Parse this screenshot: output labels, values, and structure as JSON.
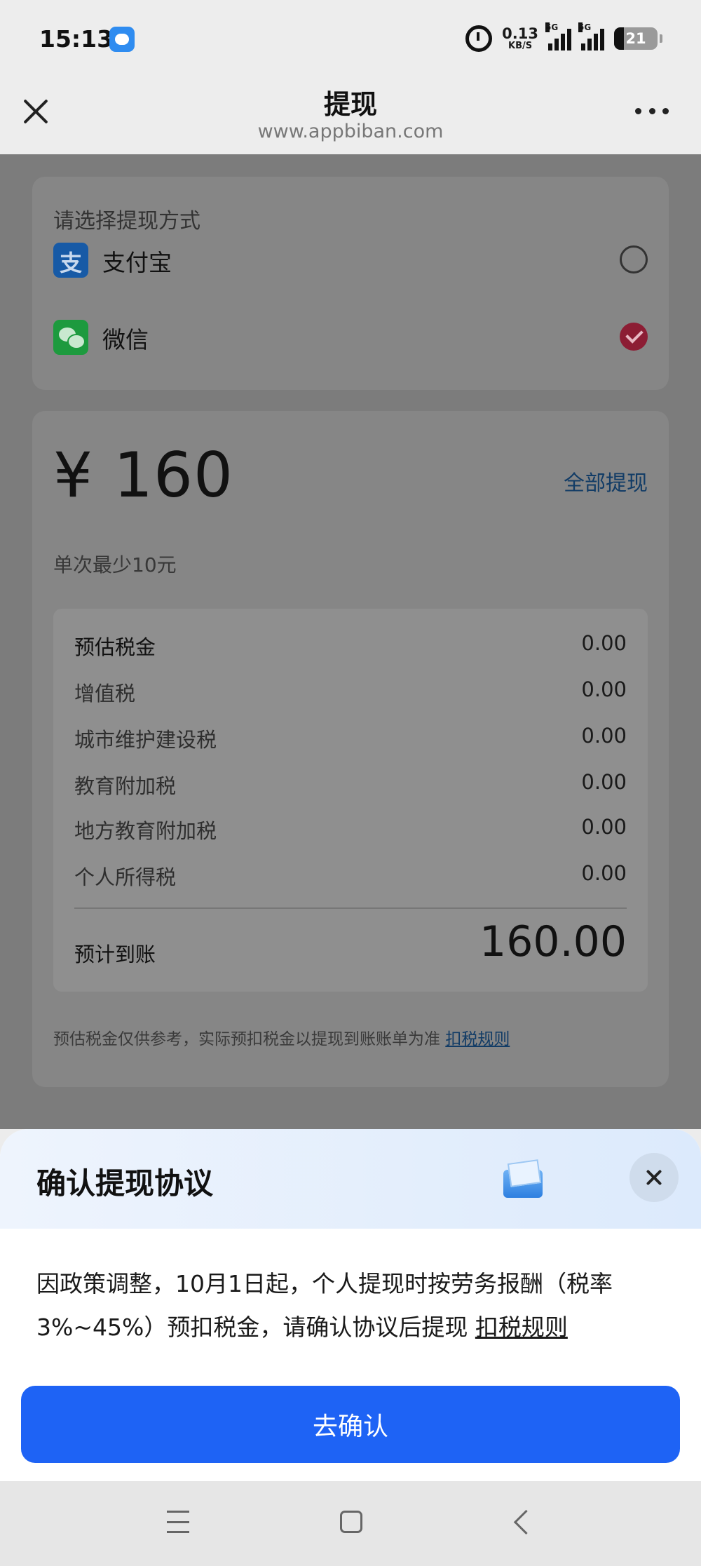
{
  "status_bar": {
    "time": "15:13",
    "net_speed_value": "0.13",
    "net_speed_unit": "KB/S",
    "sim1_label": "5G",
    "sim2_label": "5G",
    "battery": "21"
  },
  "header": {
    "title": "提现",
    "url": "www.appbiban.com"
  },
  "methods": {
    "label": "请选择提现方式",
    "items": [
      {
        "name": "支付宝",
        "icon": "alipay-icon",
        "selected": false
      },
      {
        "name": "微信",
        "icon": "wechat-icon",
        "selected": true
      }
    ]
  },
  "amount": {
    "value": "¥ 160",
    "withdraw_all": "全部提现",
    "min_note": "单次最少10元"
  },
  "tax": {
    "rows": [
      {
        "label": "预估税金",
        "value": "0.00"
      },
      {
        "label": "增值税",
        "value": "0.00"
      },
      {
        "label": "城市维护建设税",
        "value": "0.00"
      },
      {
        "label": "教育附加税",
        "value": "0.00"
      },
      {
        "label": "地方教育附加税",
        "value": "0.00"
      },
      {
        "label": "个人所得税",
        "value": "0.00"
      }
    ],
    "expected_label": "预计到账",
    "expected_value": "160.00"
  },
  "disclaimer": {
    "text": "预估税金仅供参考，实际预扣税金以提现到账账单为准 ",
    "link": "扣税规则"
  },
  "sheet": {
    "title": "确认提现协议",
    "body": "因政策调整，10月1日起，个人提现时按劳务报酬（税率3%~45%）预扣税金，请确认协议后提现 ",
    "link": "扣税规则",
    "confirm": "去确认"
  },
  "colors": {
    "primary": "#1e63f5",
    "selected": "#8c1d34"
  }
}
